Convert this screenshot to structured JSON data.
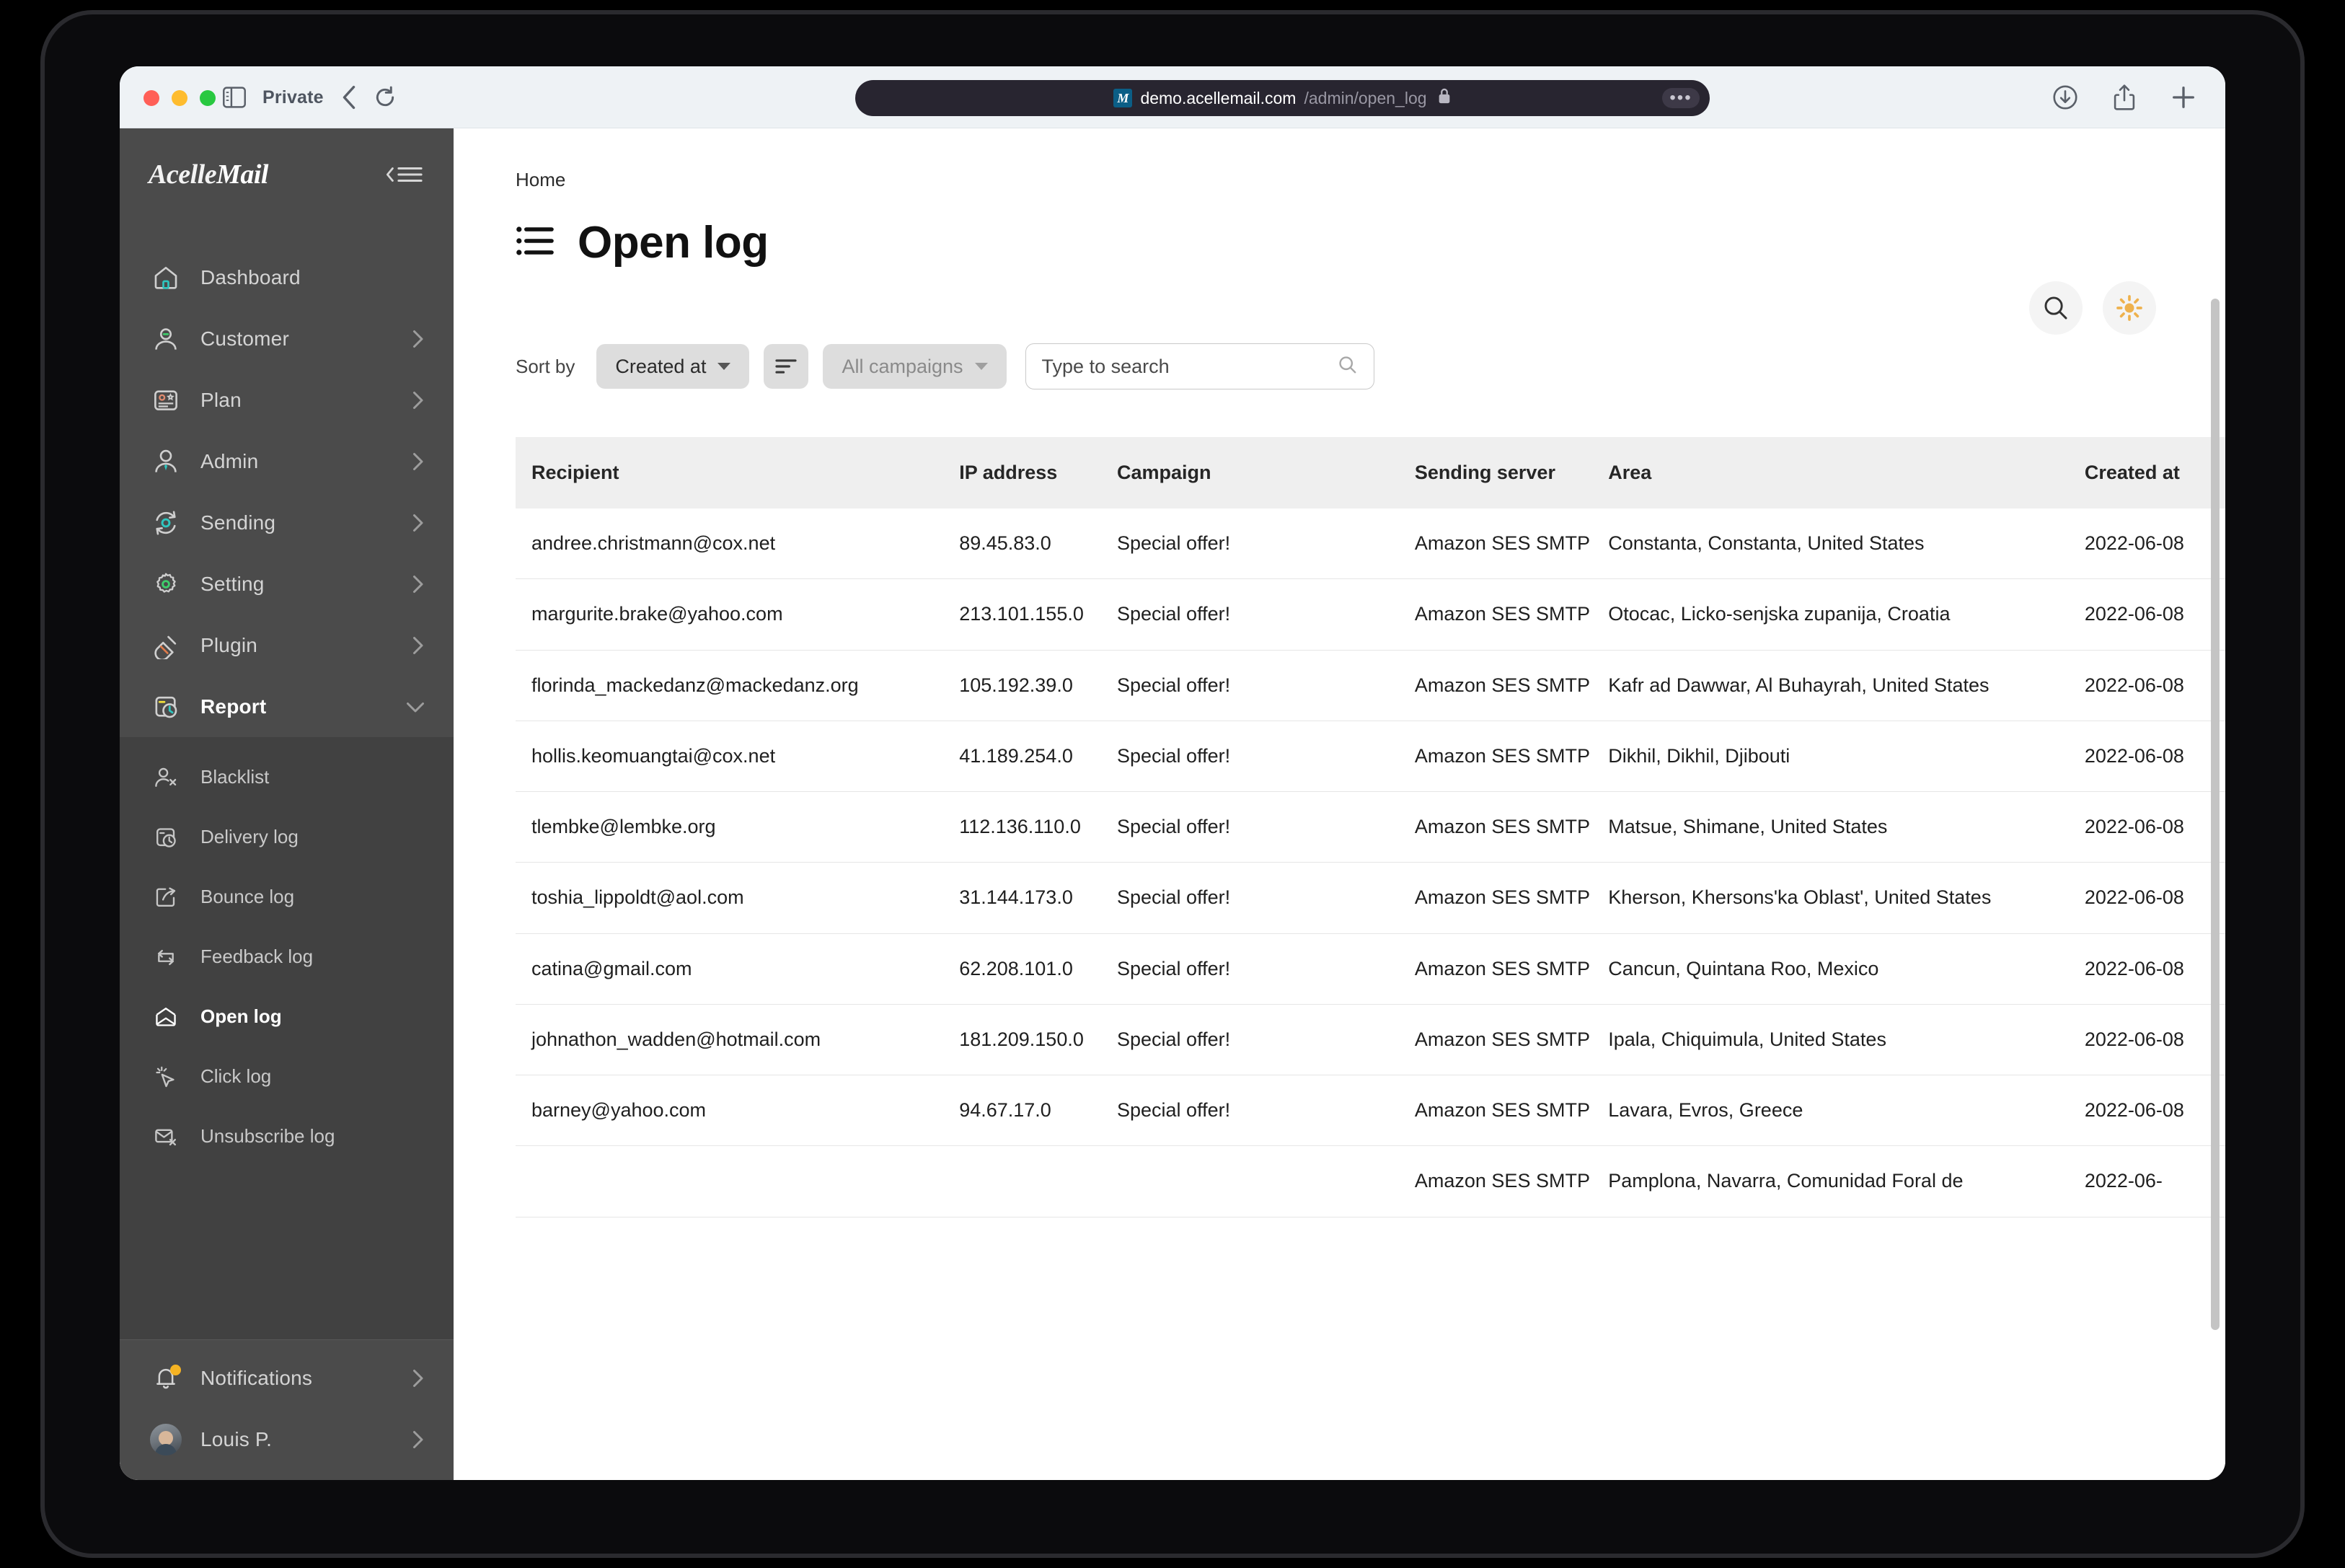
{
  "browser": {
    "private_label": "Private",
    "url_host": "demo.acellemail.com",
    "url_path": "/admin/open_log",
    "favicon_letter": "M",
    "icons": {
      "sidebar": "sidebar-toggle-icon",
      "back": "back-arrow-icon",
      "reload": "reload-icon",
      "lock": "lock-icon",
      "more": "more-dots-icon",
      "downloads": "downloads-icon",
      "share": "share-icon",
      "newtab": "new-tab-icon"
    }
  },
  "sidebar": {
    "brand": "Acelle",
    "brand_accent": "Mail",
    "collapse_icon": "collapse-menu-icon",
    "items": [
      {
        "label": "Dashboard",
        "icon": "home-icon",
        "expandable": false
      },
      {
        "label": "Customer",
        "icon": "user-icon",
        "expandable": true
      },
      {
        "label": "Plan",
        "icon": "plan-card-icon",
        "expandable": true
      },
      {
        "label": "Admin",
        "icon": "admin-user-icon",
        "expandable": true
      },
      {
        "label": "Sending",
        "icon": "sending-sync-icon",
        "expandable": true
      },
      {
        "label": "Setting",
        "icon": "gear-icon",
        "expandable": true
      },
      {
        "label": "Plugin",
        "icon": "plug-icon",
        "expandable": true
      },
      {
        "label": "Report",
        "icon": "report-clock-icon",
        "expandable": true,
        "expanded": true
      }
    ],
    "submenu": [
      {
        "label": "Blacklist",
        "icon": "user-x-icon",
        "active": false
      },
      {
        "label": "Delivery log",
        "icon": "delivery-clock-icon",
        "active": false
      },
      {
        "label": "Bounce log",
        "icon": "bounce-arrow-icon",
        "active": false
      },
      {
        "label": "Feedback log",
        "icon": "feedback-loop-icon",
        "active": false
      },
      {
        "label": "Open log",
        "icon": "open-envelope-icon",
        "active": true
      },
      {
        "label": "Click log",
        "icon": "click-cursor-icon",
        "active": false
      },
      {
        "label": "Unsubscribe log",
        "icon": "envelope-x-icon",
        "active": false
      }
    ],
    "bottom": [
      {
        "label": "Notifications",
        "icon": "bell-icon",
        "badge": true
      },
      {
        "label": "Louis P.",
        "icon": "avatar",
        "badge": false
      }
    ]
  },
  "header": {
    "breadcrumb": "Home",
    "title": "Open log",
    "title_icon": "list-icon",
    "search_icon": "search-icon",
    "theme_icon": "sun-icon"
  },
  "toolbar": {
    "sort_by_label": "Sort by",
    "sort_field": "Created at",
    "sort_order_icon": "sort-order-icon",
    "campaign_filter": "All campaigns",
    "search_placeholder": "Type to search",
    "search_value": "",
    "search_icon": "search-icon"
  },
  "table": {
    "columns": [
      "Recipient",
      "IP address",
      "Campaign",
      "Sending server",
      "Area",
      "Created at"
    ],
    "rows": [
      {
        "recipient": "andree.christmann@cox.net",
        "ip": "89.45.83.0",
        "campaign": "Special offer!",
        "server": "Amazon SES SMTP",
        "area": "Constanta, Constanta, United States",
        "created": "2022-06-08"
      },
      {
        "recipient": "margurite.brake@yahoo.com",
        "ip": "213.101.155.0",
        "campaign": "Special offer!",
        "server": "Amazon SES SMTP",
        "area": "Otocac, Licko-senjska zupanija, Croatia",
        "created": "2022-06-08"
      },
      {
        "recipient": "florinda_mackedanz@mackedanz.org",
        "ip": "105.192.39.0",
        "campaign": "Special offer!",
        "server": "Amazon SES SMTP",
        "area": "Kafr ad Dawwar, Al Buhayrah, United States",
        "created": "2022-06-08"
      },
      {
        "recipient": "hollis.keomuangtai@cox.net",
        "ip": "41.189.254.0",
        "campaign": "Special offer!",
        "server": "Amazon SES SMTP",
        "area": "Dikhil, Dikhil, Djibouti",
        "created": "2022-06-08"
      },
      {
        "recipient": "tlembke@lembke.org",
        "ip": "112.136.110.0",
        "campaign": "Special offer!",
        "server": "Amazon SES SMTP",
        "area": "Matsue, Shimane, United States",
        "created": "2022-06-08"
      },
      {
        "recipient": "toshia_lippoldt@aol.com",
        "ip": "31.144.173.0",
        "campaign": "Special offer!",
        "server": "Amazon SES SMTP",
        "area": "Kherson, Khersons'ka Oblast', United States",
        "created": "2022-06-08"
      },
      {
        "recipient": "catina@gmail.com",
        "ip": "62.208.101.0",
        "campaign": "Special offer!",
        "server": "Amazon SES SMTP",
        "area": "Cancun, Quintana Roo, Mexico",
        "created": "2022-06-08"
      },
      {
        "recipient": "johnathon_wadden@hotmail.com",
        "ip": "181.209.150.0",
        "campaign": "Special offer!",
        "server": "Amazon SES SMTP",
        "area": "Ipala, Chiquimula, United States",
        "created": "2022-06-08"
      },
      {
        "recipient": "barney@yahoo.com",
        "ip": "94.67.17.0",
        "campaign": "Special offer!",
        "server": "Amazon SES SMTP",
        "area": "Lavara, Evros, Greece",
        "created": "2022-06-08"
      },
      {
        "recipient": "",
        "ip": "",
        "campaign": "",
        "server": "Amazon SES SMTP",
        "area": "Pamplona, Navarra, Comunidad Foral de",
        "created": "2022-06-"
      }
    ]
  },
  "colors": {
    "sidebar_bg": "#4b4b4b",
    "submenu_bg": "#414141",
    "accent_orange": "#f5b323",
    "accent_teal": "#2ec7c0",
    "header_row_bg": "#efefef"
  }
}
